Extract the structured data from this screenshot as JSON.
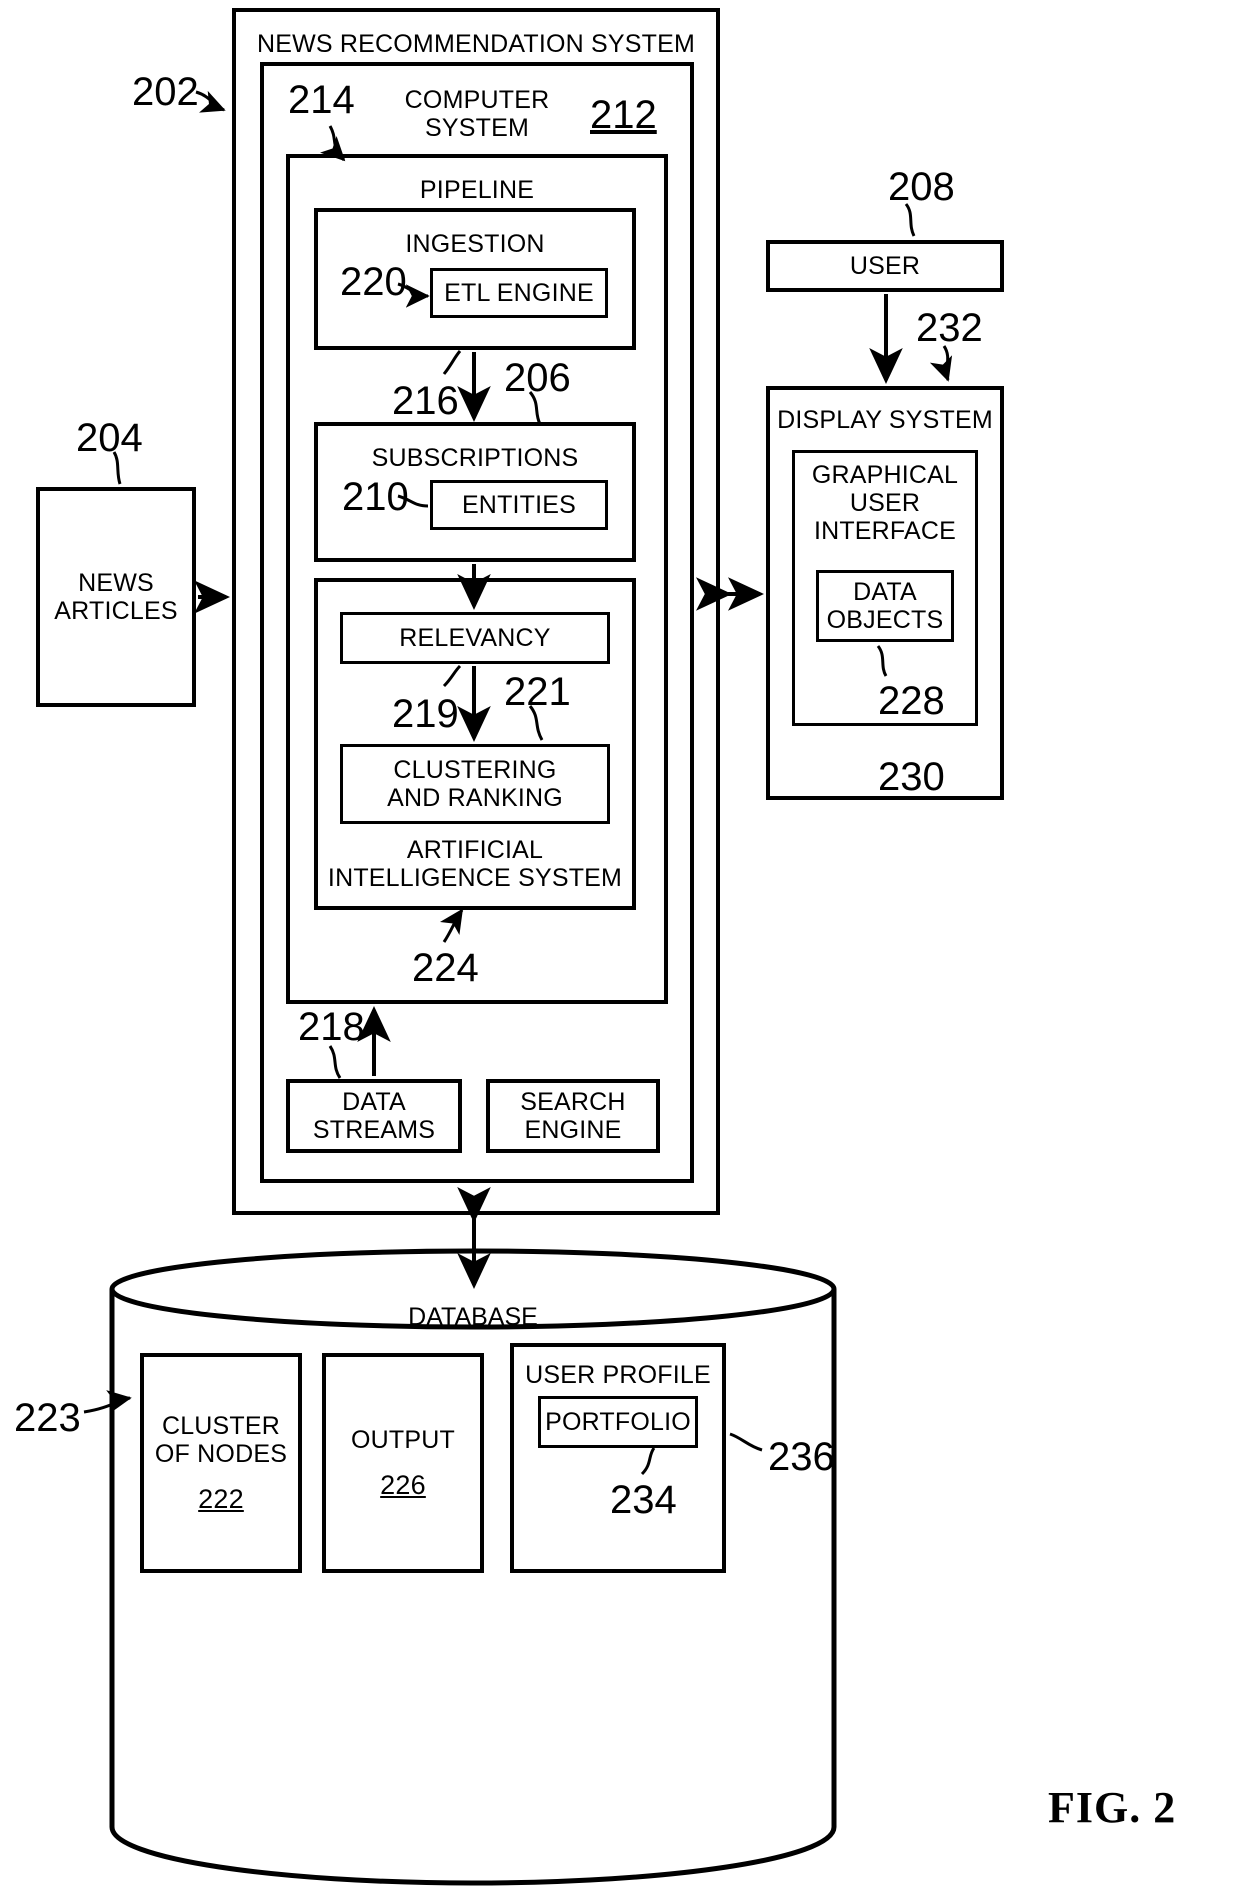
{
  "figure": {
    "caption": "FIG. 2"
  },
  "blocks": {
    "news_recommendation_system": {
      "title": "NEWS RECOMMENDATION SYSTEM",
      "ref": "202"
    },
    "computer_system": {
      "title": "COMPUTER\nSYSTEM",
      "ref_left": "214",
      "ref_right": "212"
    },
    "pipeline": {
      "title": "PIPELINE",
      "ref": "206"
    },
    "ingestion": {
      "title": "INGESTION",
      "ref": "216"
    },
    "etl_engine": {
      "title": "ETL ENGINE",
      "ref": "220"
    },
    "subscriptions": {
      "title": "SUBSCRIPTIONS"
    },
    "entities": {
      "title": "ENTITIES",
      "ref": "210"
    },
    "ai_system": {
      "title": "ARTIFICIAL\nINTELLIGENCE SYSTEM",
      "ref": "224"
    },
    "relevancy": {
      "title": "RELEVANCY",
      "ref": "219"
    },
    "clustering_and_ranking": {
      "title": "CLUSTERING\nAND RANKING",
      "ref": "221"
    },
    "data_streams": {
      "title": "DATA\nSTREAMS",
      "ref": "218"
    },
    "search_engine": {
      "title": "SEARCH\nENGINE"
    },
    "news_articles": {
      "title": "NEWS\nARTICLES",
      "ref": "204"
    },
    "user": {
      "title": "USER",
      "ref": "208"
    },
    "display_system": {
      "title": "DISPLAY SYSTEM",
      "ref": "232",
      "ref_bottom": "230"
    },
    "graphical_user_interface": {
      "title": "GRAPHICAL\nUSER\nINTERFACE"
    },
    "data_objects": {
      "title": "DATA\nOBJECTS",
      "ref": "228"
    },
    "database": {
      "title": "DATABASE",
      "ref": "223"
    },
    "cluster_of_nodes": {
      "title": "CLUSTER\nOF NODES",
      "ref": "222"
    },
    "output": {
      "title": "OUTPUT",
      "ref": "226"
    },
    "user_profile": {
      "title": "USER PROFILE",
      "ref": "236"
    },
    "portfolio": {
      "title": "PORTFOLIO",
      "ref": "234"
    }
  }
}
